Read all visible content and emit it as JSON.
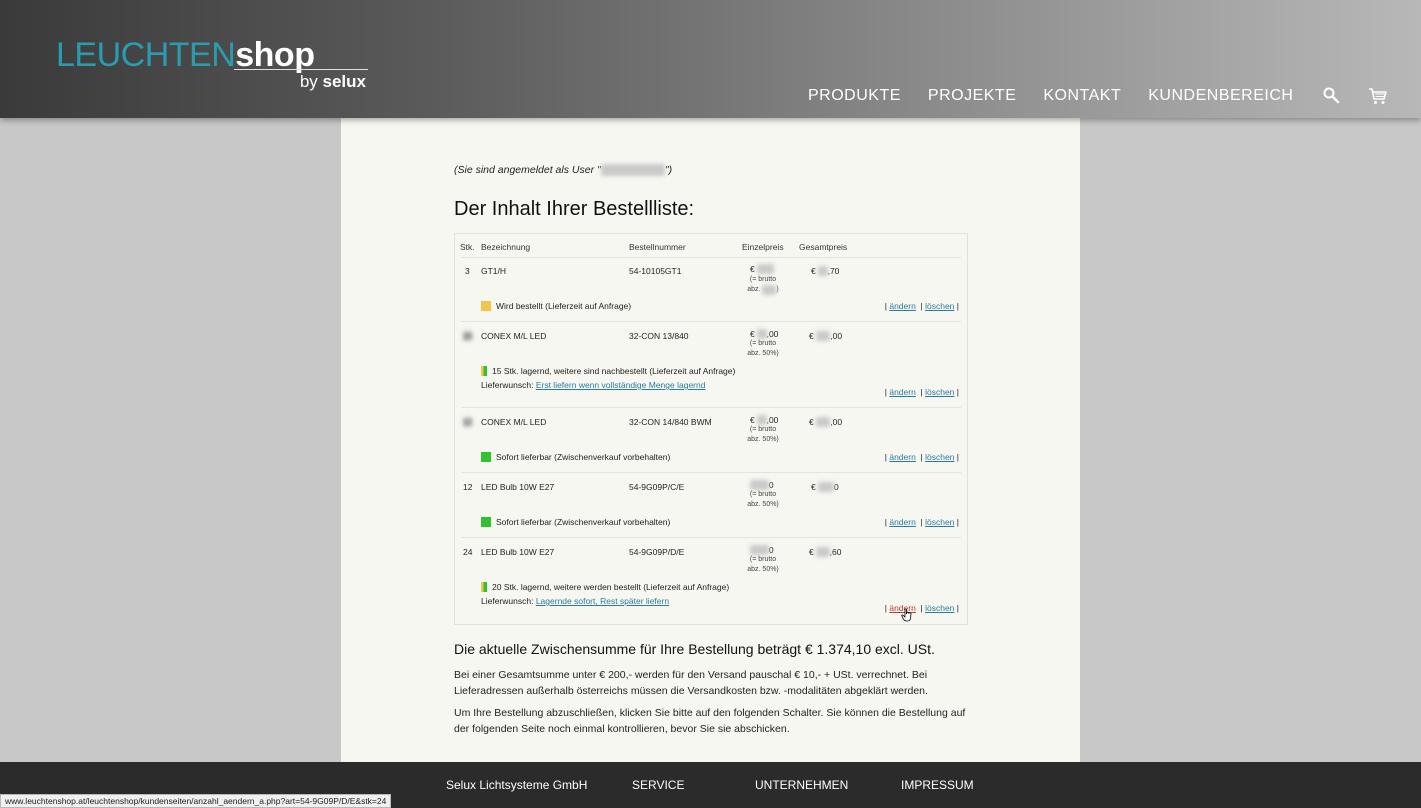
{
  "header": {
    "logo_leuchten": "LEUCHTEN",
    "logo_shop": "shop",
    "logo_by": "by",
    "logo_selux": "selux",
    "nav": [
      "PRODUKTE",
      "PROJEKTE",
      "KONTAKT",
      "KUNDENBEREICH"
    ],
    "icons": [
      "search-icon",
      "cart-icon"
    ]
  },
  "main": {
    "login_prefix": "(Sie sind angemeldet als User \"",
    "login_suffix": "\")",
    "title": "Der Inhalt Ihrer Bestellliste:",
    "columns": {
      "qty": "Stk.",
      "name": "Bezeichnung",
      "sku": "Bestellnummer",
      "unit": "Einzelpreis",
      "total": "Gesamtpreis"
    },
    "price_note_line1": "(= brutto",
    "price_note_line2": "abz.",
    "items": [
      {
        "qty": "3",
        "name": "GT1/H",
        "sku": "54-10105GT1",
        "unit_prefix": "€",
        "unit_suffix": "",
        "discount": "",
        "total_prefix": "€",
        "total_suffix": ",70",
        "status_color": "yellow",
        "status": "Wird bestellt (Lieferzeit auf Anfrage)",
        "wish_label": "",
        "wish_link": ""
      },
      {
        "qty": "",
        "name": "CONEX M/L LED",
        "sku": "32-CON 13/840",
        "unit_prefix": "€",
        "unit_suffix": ",00",
        "discount": "50%)",
        "total_prefix": "€",
        "total_suffix": ",00",
        "status_color": "split",
        "status": "15 Stk. lagernd, weitere sind nachbestellt (Lieferzeit auf Anfrage)",
        "wish_label": "Lieferwunsch:",
        "wish_link": "Erst liefern wenn vollständige Menge lagernd"
      },
      {
        "qty": "",
        "name": "CONEX M/L LED",
        "sku": "32-CON 14/840 BWM",
        "unit_prefix": "€",
        "unit_suffix": ",00",
        "discount": "50%)",
        "total_prefix": "€",
        "total_suffix": ",00",
        "status_color": "green",
        "status": "Sofort lieferbar (Zwischenverkauf vorbehalten)",
        "wish_label": "",
        "wish_link": ""
      },
      {
        "qty": "12",
        "name": "LED Bulb 10W E27",
        "sku": "54-9G09P/C/E",
        "unit_prefix": "",
        "unit_suffix": "0",
        "discount": "50%)",
        "total_prefix": "€",
        "total_suffix": "0",
        "status_color": "green",
        "status": "Sofort lieferbar (Zwischenverkauf vorbehalten)",
        "wish_label": "",
        "wish_link": ""
      },
      {
        "qty": "24",
        "name": "LED Bulb 10W E27",
        "sku": "54-9G09P/D/E",
        "unit_prefix": "",
        "unit_suffix": "0",
        "discount": "50%)",
        "total_prefix": "€",
        "total_suffix": ",60",
        "status_color": "split",
        "status": "20 Stk. lagernd, weitere werden bestellt (Lieferzeit auf Anfrage)",
        "wish_label": "Lieferwunsch:",
        "wish_link": "Lagernde sofort, Rest später liefern"
      }
    ],
    "action_edit": "ändern",
    "action_delete": "löschen",
    "subtotal": "Die aktuelle Zwischensumme für Ihre Bestellung beträgt € 1.374,10 excl. USt.",
    "shipping_text": "Bei einer Gesamtsumme unter € 200,- werden für den Versand pauschal € 10,- + USt. verrechnet. Bei Lieferadressen außerhalb österreichs müssen die Versandkosten bzw. -modalitäten abgeklärt werden.",
    "finish_text": "Um Ihre Bestellung abzuschließen, klicken Sie bitte auf den folgenden Schalter. Sie können die Bestellung auf der folgenden Seite noch einmal kontrollieren, bevor Sie sie abschicken."
  },
  "footer": {
    "items": [
      "Selux Lichtsysteme GmbH",
      "SERVICE",
      "UNTERNEHMEN",
      "IMPRESSUM"
    ]
  },
  "statusbar": {
    "url": "www.leuchtenshop.at/leuchtenshop/kundenseiten/anzahl_aendern_a.php?art=54-9G09P/D/E&stk=24"
  },
  "colors": {
    "brand_teal": "#2a9cb0",
    "status_yellow": "#f2c64a",
    "status_green": "#32c12f",
    "link": "#2a7c9c"
  }
}
